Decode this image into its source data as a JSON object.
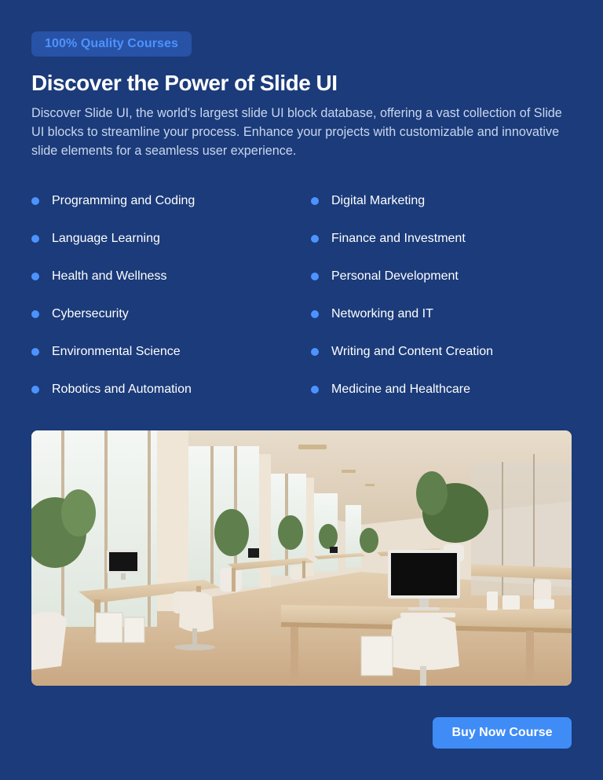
{
  "badge": "100% Quality Courses",
  "title": "Discover the Power of Slide UI",
  "description": "Discover Slide UI, the world's largest slide UI block database, offering a vast collection of Slide UI blocks to streamline your process. Enhance your projects with customizable and innovative slide elements for a seamless user experience.",
  "features": {
    "left": [
      "Programming and Coding",
      "Language Learning",
      "Health and Wellness",
      "Cybersecurity",
      "Environmental Science",
      "Robotics and Automation"
    ],
    "right": [
      "Digital Marketing",
      "Finance and Investment",
      "Personal Development",
      "Networking and IT",
      "Writing and Content Creation",
      "Medicine and Healthcare"
    ]
  },
  "cta": {
    "label": "Buy Now Course"
  },
  "colors": {
    "background": "#1b3b7a",
    "accent": "#3f8cf6",
    "badge_bg": "#2852a6",
    "badge_text": "#4d93ff",
    "bullet": "#4d93ff"
  },
  "image": {
    "icon": "office-photo"
  }
}
